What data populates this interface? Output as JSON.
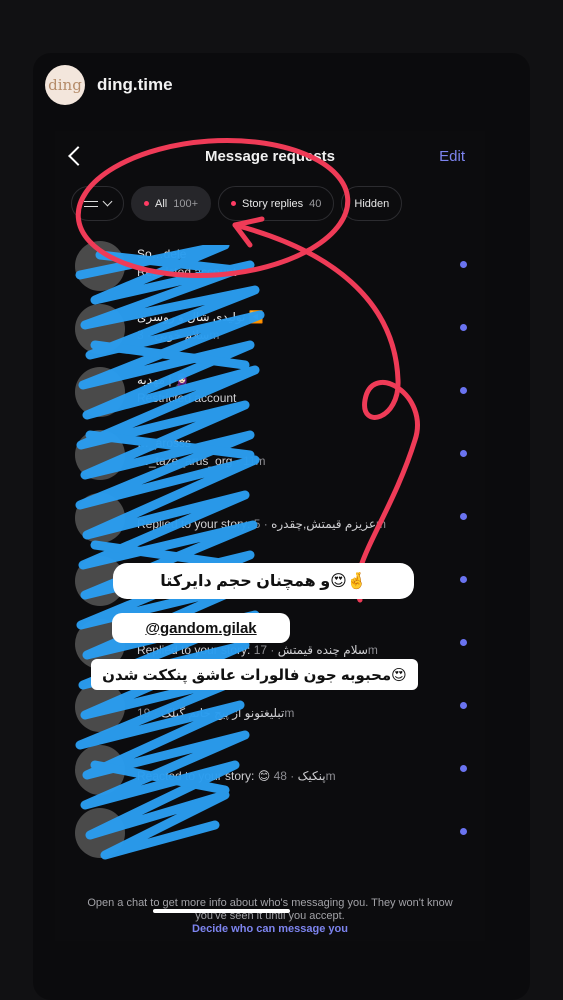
{
  "story": {
    "avatar_text": "ding",
    "username": "ding.time"
  },
  "header": {
    "title": "Message requests",
    "edit_label": "Edit"
  },
  "filters": [
    {
      "label": "All",
      "count": "100+"
    },
    {
      "label": "Story replies",
      "count": "40"
    },
    {
      "label": "Hidden",
      "count": ""
    }
  ],
  "rows": [
    {
      "name": "So…dele",
      "sub": "Restricted account",
      "time": ""
    },
    {
      "name": "تولیدی شال و روسری ◀️",
      "sub": "سلام خوبی",
      "time": "· 3m"
    },
    {
      "name": "مهدیه | 🧕🏻",
      "sub": "Restricted account",
      "time": ""
    },
    {
      "name": "…_arosss",
      "sub": "…_taze_arus_org",
      "time": "· 11m"
    },
    {
      "name": "",
      "sub": "Replied to your story: عزیزم قیمتش,چقدره",
      "time": "· 5m"
    },
    {
      "name": "",
      "sub": "",
      "time": ""
    },
    {
      "name": "",
      "sub": "Replied to your story: سلام چنده قیمتش",
      "time": "· 17m"
    },
    {
      "name": "",
      "sub": "تبلیغتونو از پیج خانم گیلک",
      "time": "· 19m"
    },
    {
      "name": "",
      "sub": "Reacted to your story: 😊 پنکیک",
      "time": "· 48m"
    },
    {
      "name": "",
      "sub": "",
      "time": ""
    }
  ],
  "footer": {
    "note": "Open a chat to get more info about who's messaging you. They won't know you've seen it until you accept.",
    "link": "Decide who can message you"
  },
  "stickers": {
    "line1": "و همچنان حجم دایرکتا😍🤞",
    "mention": "@gandom.gilak",
    "line3": "محبوبه جون فالورات عاشق پنککت شدن😍"
  },
  "colors": {
    "accent": "#7d84ef",
    "unread_dot": "#6a73f0",
    "filter_dot": "#ff3c64",
    "annotation": "#ef3b57",
    "scribble": "#2a9df0"
  }
}
